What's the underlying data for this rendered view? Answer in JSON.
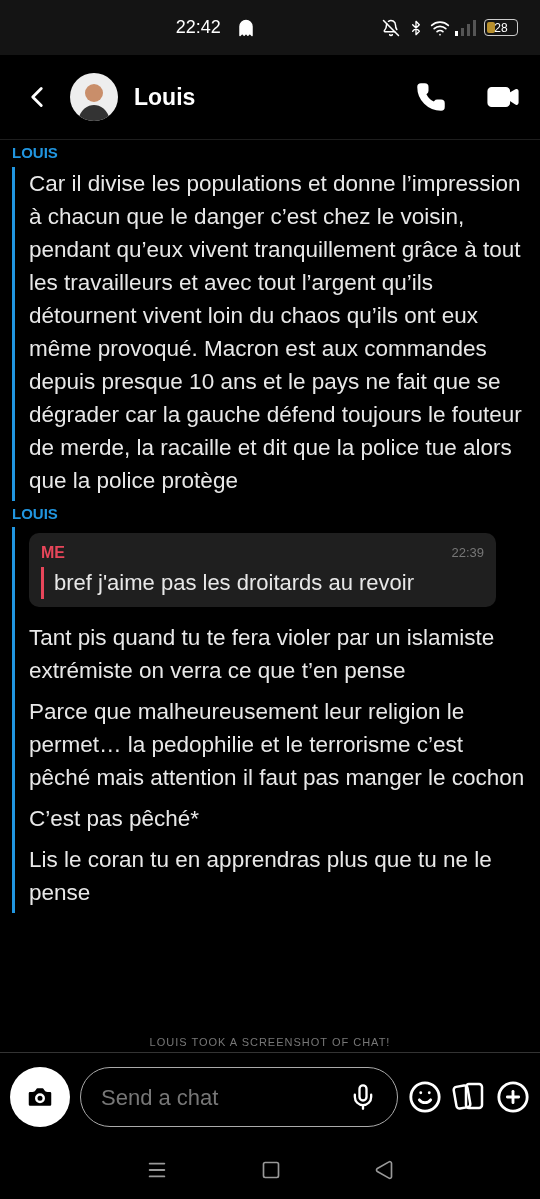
{
  "status_bar": {
    "time": "22:42",
    "battery": "28"
  },
  "header": {
    "name": "Louis"
  },
  "groups": [
    {
      "sender": "LOUIS",
      "color": "#2196e0",
      "messages": [
        {
          "kind": "text",
          "text": "Car il divise les populations et donne l’impression à chacun que le danger c’est chez le voisin, pendant qu’eux vivent tranquillement grâce à tout les travailleurs et avec tout l’argent qu’ils détournent vivent loin du chaos qu’ils ont eux même provoqué. Macron est aux commandes depuis presque 10 ans et le pays ne fait que se dégrader car la gauche défend toujours le fouteur de merde, la racaille et dit que la police tue alors que la police protège"
        }
      ]
    },
    {
      "sender": "LOUIS",
      "color": "#2196e0",
      "messages": [
        {
          "kind": "quote",
          "sender": "ME",
          "color": "#e8465a",
          "time": "22:39",
          "text": "bref j'aime pas les droitards au revoir"
        },
        {
          "kind": "text",
          "text": "Tant pis quand tu te fera violer par un islamiste extrémiste on verra ce que t’en pense"
        },
        {
          "kind": "text",
          "text": "Parce que malheureusement leur religion le permet… la pedophilie et le terrorisme c’est pêché mais attention il faut pas manger le cochon"
        },
        {
          "kind": "text",
          "text": "C’est pas pêché*"
        },
        {
          "kind": "text",
          "text": "Lis le coran tu en apprendras plus que tu ne le pense"
        }
      ]
    }
  ],
  "notice": "LOUIS TOOK A SCREENSHOT OF CHAT!",
  "composer": {
    "placeholder": "Send a chat"
  }
}
